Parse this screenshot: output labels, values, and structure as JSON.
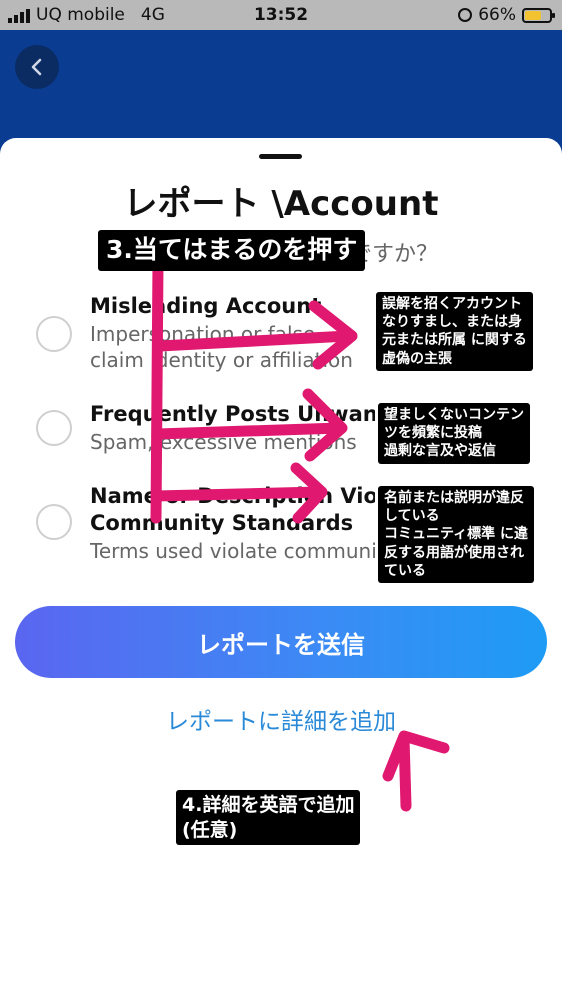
{
  "status_bar": {
    "carrier": "UQ mobile",
    "network": "4G",
    "time": "13:52",
    "battery": "66%"
  },
  "sheet": {
    "title": "レポート \\Account",
    "subtitle": "ですか？",
    "options": [
      {
        "title": "Misleading Account",
        "description": "Impersonation or false claim identity or affiliation"
      },
      {
        "title": "Frequently Posts Unwanted",
        "description": "Spam, excessive mentions"
      },
      {
        "title": "Name or Description Violates",
        "title2": "Community Standards",
        "description": "Terms used violate community"
      }
    ],
    "submit_label": "レポートを送信",
    "add_details_label": "レポートに詳細を追加"
  },
  "annotations": {
    "step3": "3.当てはまるのを押す",
    "note1": [
      "誤解を招くアカウント",
      "なりすまし、または身",
      "元または所属 に関する",
      "虚偽の主張"
    ],
    "note2": [
      "望ましくないコンテン",
      "ツを頻繁に投稿",
      "過剰な言及や返信"
    ],
    "note3": [
      "名前または説明が違反",
      "している",
      "コミュニティ標準 に違",
      "反する用語が使用され",
      "ている"
    ],
    "step4": [
      "4.詳細を英語で追加",
      "(任意)"
    ]
  },
  "colors": {
    "header_blue": "#0a3d91",
    "annotation_magenta": "#e0186f",
    "link_blue": "#2a8ad8"
  }
}
